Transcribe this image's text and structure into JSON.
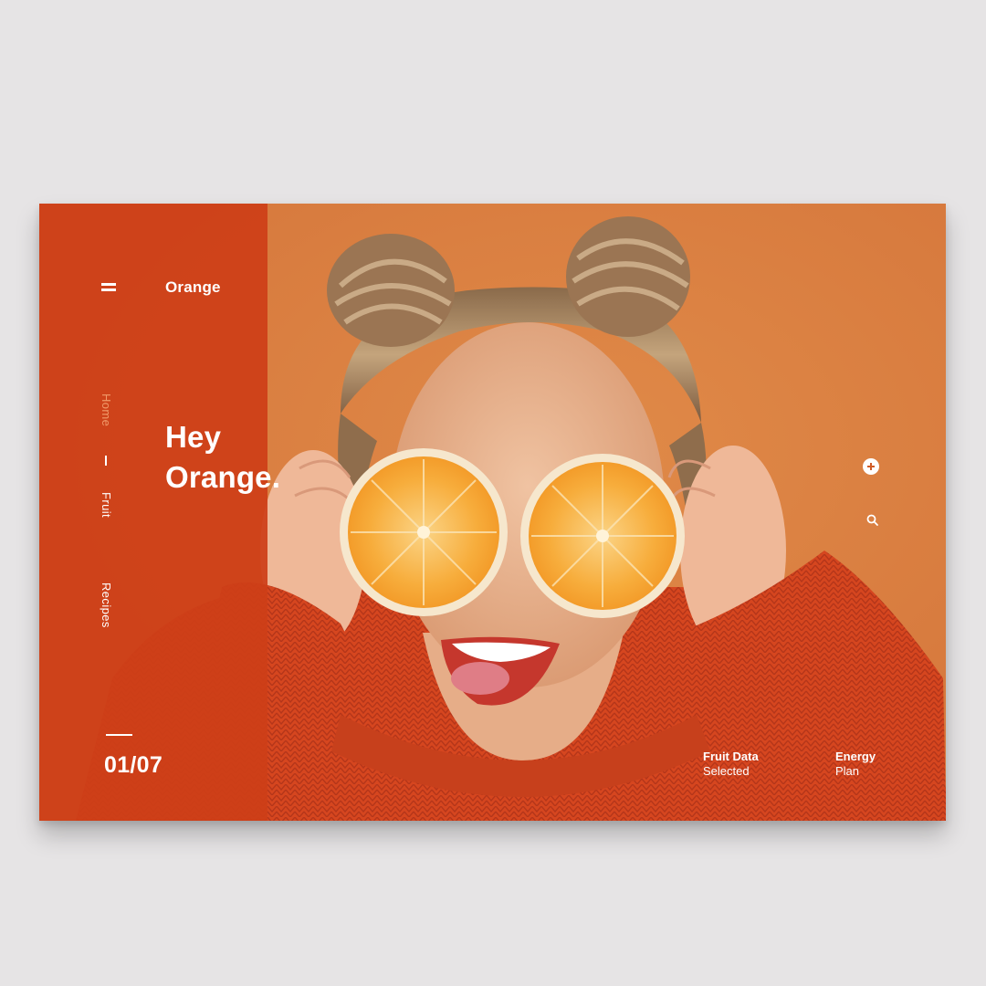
{
  "app": {
    "brand": "Orange",
    "headline_line1": "Hey",
    "headline_line2": "Orange."
  },
  "nav": {
    "items": [
      {
        "label": "Home",
        "active": true
      },
      {
        "label": "Fruit",
        "active": false
      },
      {
        "label": "Recipes",
        "active": false
      }
    ]
  },
  "slider": {
    "counter": "01/07"
  },
  "info": {
    "fruit_title": "Fruit Data",
    "fruit_sub": "Selected",
    "energy_title": "Energy",
    "energy_sub": "Plan"
  },
  "icons": {
    "menu": "hamburger-menu-icon",
    "add": "plus-icon",
    "search": "search-icon"
  },
  "colors": {
    "background": "#e6e4e5",
    "side_panel": "#ce3e18",
    "photo_background": "#d97a3f",
    "accent_text": "#f09a6a",
    "sweater": "#d94a22",
    "orange_fruit": "#f7a938"
  }
}
